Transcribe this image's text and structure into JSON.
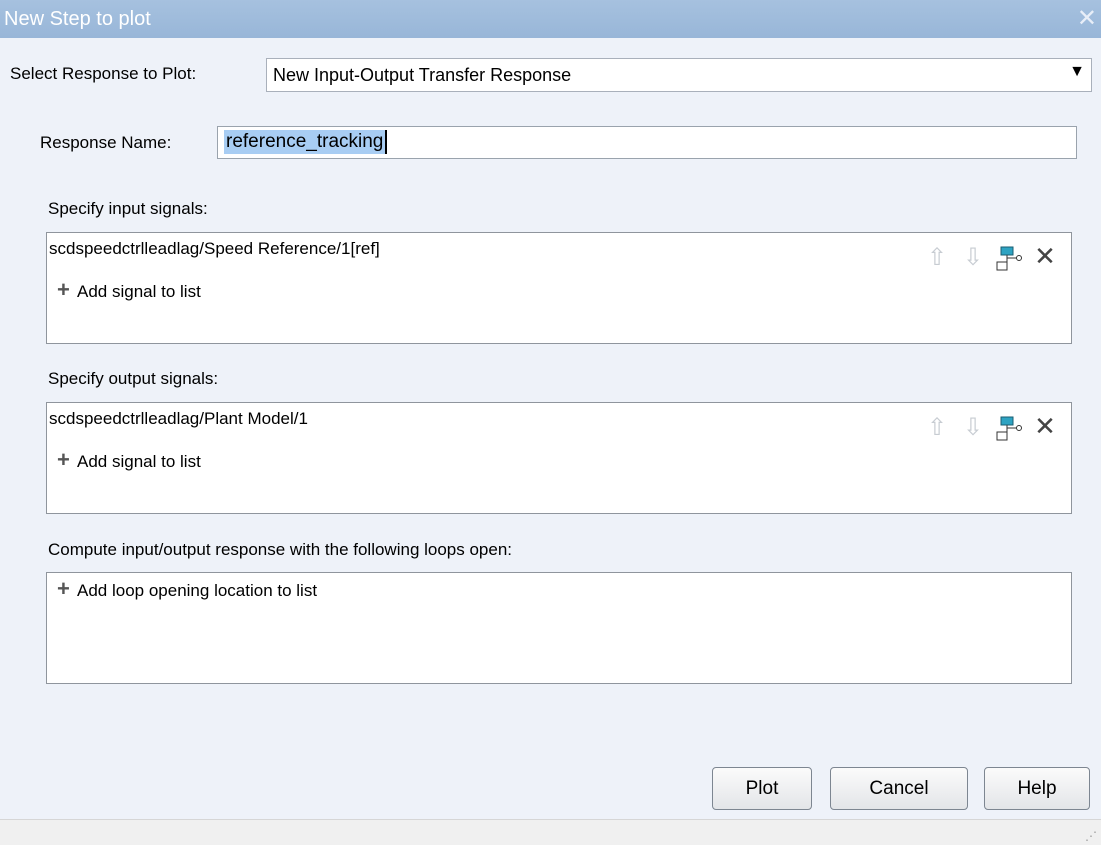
{
  "window": {
    "title": "New Step to plot",
    "close_glyph": "✕"
  },
  "select_response": {
    "label": "Select Response to Plot:",
    "value": "New Input-Output Transfer Response"
  },
  "response_name": {
    "label": "Response Name:",
    "value": "reference_tracking"
  },
  "inputs": {
    "label": "Specify input signals:",
    "signal": "scdspeedctrlleadlag/Speed Reference/1[ref]",
    "add_label": "Add signal to list"
  },
  "outputs": {
    "label": "Specify output signals:",
    "signal": "scdspeedctrlleadlag/Plant Model/1",
    "add_label": "Add signal to list"
  },
  "loops": {
    "label": "Compute input/output response with the following loops open:",
    "add_label": "Add loop opening location to list"
  },
  "buttons": {
    "plot": "Plot",
    "cancel": "Cancel",
    "help": "Help"
  }
}
